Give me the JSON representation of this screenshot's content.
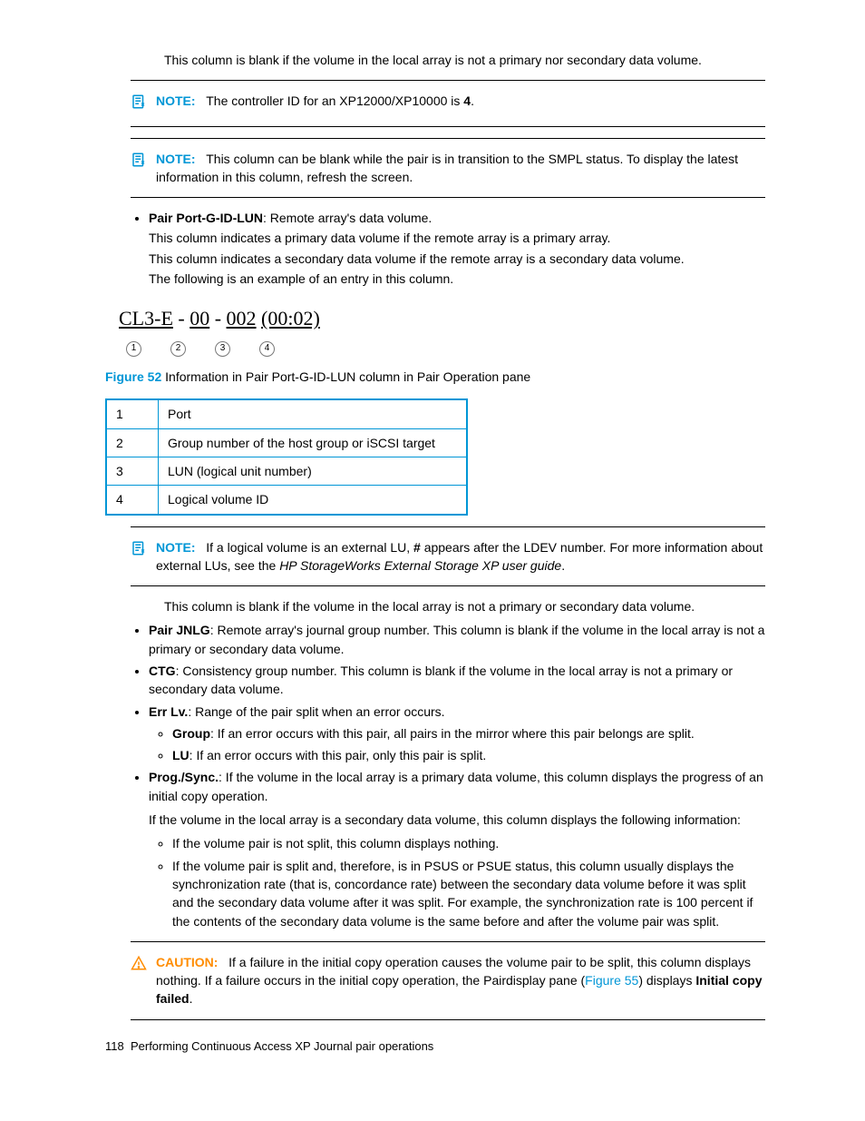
{
  "intro_para": "This column is blank if the volume in the local array is not a primary nor secondary data volume.",
  "note1": {
    "label": "NOTE:",
    "text": "The controller ID for an XP12000/XP10000 is ",
    "bold": "4",
    "after": "."
  },
  "note2": {
    "label": "NOTE:",
    "text": "This column can be blank while the pair is in transition to the SMPL status. To display the latest information in this column, refresh the screen."
  },
  "bullet_pair_port": {
    "term": "Pair Port-G-ID-LUN",
    "desc": ": Remote array's data volume.",
    "p1": "This column indicates a primary data volume if the remote array is a primary array.",
    "p2": "This column indicates a secondary data volume if the remote array is a secondary data volume.",
    "p3": "The following is an example of an entry in this column."
  },
  "figure_text": {
    "seg1": "CL3-E",
    "seg2": "00",
    "seg3": "002",
    "seg4": "(00:02)"
  },
  "figure_caption": {
    "num": "Figure 52",
    "text": " Information in Pair Port-G-ID-LUN column in Pair Operation pane"
  },
  "legend": [
    {
      "n": "1",
      "t": "Port"
    },
    {
      "n": "2",
      "t": "Group number of the host group or iSCSI target"
    },
    {
      "n": "3",
      "t": "LUN (logical unit number)"
    },
    {
      "n": "4",
      "t": "Logical volume ID"
    }
  ],
  "note3": {
    "label": "NOTE:",
    "t1": "If a logical volume is an external LU, ",
    "bold1": "#",
    "t2": " appears after the LDEV number. For more information about external LUs, see the ",
    "italic": "HP StorageWorks External Storage XP user guide",
    "t3": "."
  },
  "after_note3": "This column is blank if the volume in the local array is not a primary or secondary data volume.",
  "bullets": {
    "pair_jnlg": {
      "term": "Pair JNLG",
      "text": ": Remote array's journal group number. This column is blank if the volume in the local array is not a primary or secondary data volume."
    },
    "ctg": {
      "term": "CTG",
      "text": ": Consistency group number. This column is blank if the volume in the local array is not a primary or secondary data volume."
    },
    "err_lv": {
      "term": "Err Lv.",
      "text": ": Range of the pair split when an error occurs.",
      "sub": {
        "group": {
          "term": "Group",
          "text": ": If an error occurs with this pair, all pairs in the mirror where this pair belongs are split."
        },
        "lu": {
          "term": "LU",
          "text": ": If an error occurs with this pair, only this pair is split."
        }
      }
    },
    "prog_sync": {
      "term": "Prog./Sync.",
      "text": ": If the volume in the local array is a primary data volume, this column displays the progress of an initial copy operation.",
      "p2": "If the volume in the local array is a secondary data volume, this column displays the following information:",
      "sub1": "If the volume pair is not split, this column displays nothing.",
      "sub2": "If the volume pair is split and, therefore, is in PSUS or PSUE status, this column usually displays the synchronization rate (that is, concordance rate) between the secondary data volume before it was split and the secondary data volume after it was split. For example, the synchronization rate is 100 percent if the contents of the secondary data volume is the same before and after the volume pair was split."
    }
  },
  "caution": {
    "label": "CAUTION:",
    "t1": "If a failure in the initial copy operation causes the volume pair to be split, this column displays nothing. If a failure occurs in the initial copy operation, the Pairdisplay pane (",
    "link": "Figure 55",
    "t2": ") displays ",
    "bold": "Initial copy failed",
    "t3": "."
  },
  "footer": {
    "pagenum": "118",
    "title": "Performing Continuous Access XP Journal pair operations"
  }
}
